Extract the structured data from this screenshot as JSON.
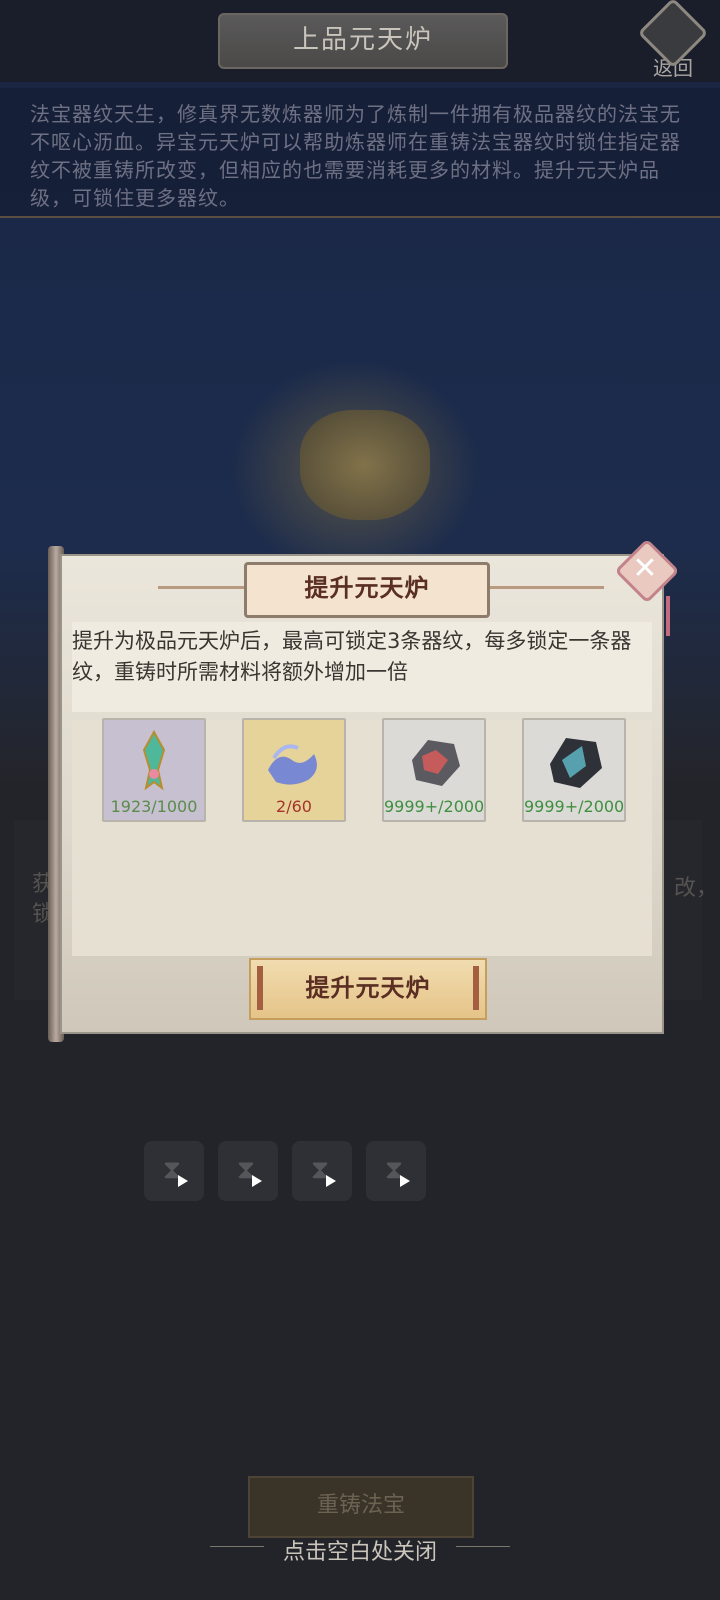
{
  "header": {
    "title": "上品元天炉",
    "back_label": "返回"
  },
  "description": "法宝器纹天生，修真界无数炼器师为了炼制一件拥有极品器纹的法宝无不呕心沥血。异宝元天炉可以帮助炼器师在重铸法宝器纹时锁住指定器纹不被重铸所改变，但相应的也需要消耗更多的材料。提升元天炉品级，可锁住更多器纹。",
  "lower_panel": {
    "text_left": "获\n锁",
    "text_right": "改，"
  },
  "lock_slots": [
    {
      "icon": "hourglass-icon"
    },
    {
      "icon": "hourglass-icon"
    },
    {
      "icon": "hourglass-icon"
    },
    {
      "icon": "hourglass-icon"
    }
  ],
  "recast_button": "重铸法宝",
  "close_hint": "点击空白处关闭",
  "modal": {
    "title": "提升元天炉",
    "description": "提升为极品元天炉后，最高可锁定3条器纹，每多锁定一条器纹，重铸时所需材料将额外增加一倍",
    "materials": [
      {
        "icon": "jade-sword-pendant-icon",
        "count": "1923/1000",
        "count_color": "#5a8c4a",
        "bg": "#c7c0d0"
      },
      {
        "icon": "blue-wave-essence-icon",
        "count": "2/60",
        "count_color": "#a5342a",
        "bg": "#e6d39a"
      },
      {
        "icon": "red-vein-ore-icon",
        "count": "9999+/2000",
        "count_color": "#3f8f3f",
        "bg": "#dcdad6"
      },
      {
        "icon": "dark-crystal-ore-icon",
        "count": "9999+/2000",
        "count_color": "#3f8f3f",
        "bg": "#dcdad6"
      }
    ],
    "confirm_button": "提升元天炉"
  }
}
